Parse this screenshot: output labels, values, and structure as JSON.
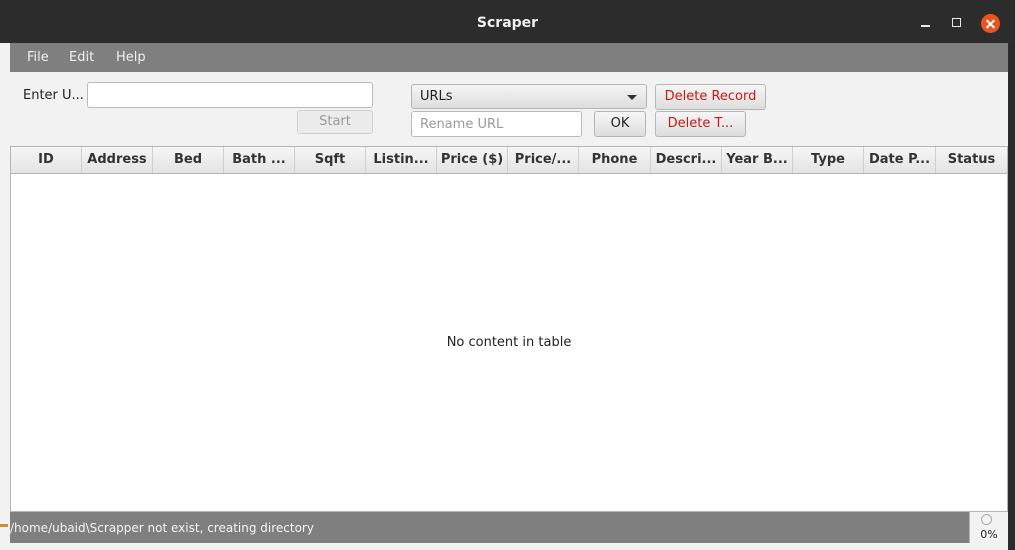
{
  "window": {
    "title": "Scraper"
  },
  "menu": {
    "file": "File",
    "edit": "Edit",
    "help": "Help"
  },
  "toolbar": {
    "enter_label": "Enter U...",
    "url_value": "",
    "start_label": "Start",
    "urls_select": "URLs",
    "rename_placeholder": "Rename URL",
    "ok_label": "OK",
    "delete_record_label": "Delete Record",
    "delete_t_label": "Delete T..."
  },
  "table": {
    "columns": [
      "ID",
      "Address",
      "Bed",
      "Bath ...",
      "Sqft",
      "Listin...",
      "Price ($)",
      "Price/...",
      "Phone",
      "Descri...",
      "Year B...",
      "Type",
      "Date P...",
      "Status"
    ],
    "empty_message": "No content in table"
  },
  "status": {
    "message": "/home/ubaid\\Scrapper not exist, creating directory",
    "progress_label": "0%",
    "progress_value": 0
  },
  "colors": {
    "danger_text": "#c81818",
    "close_button": "#e95420",
    "bar_gray": "#7f7f7f"
  }
}
